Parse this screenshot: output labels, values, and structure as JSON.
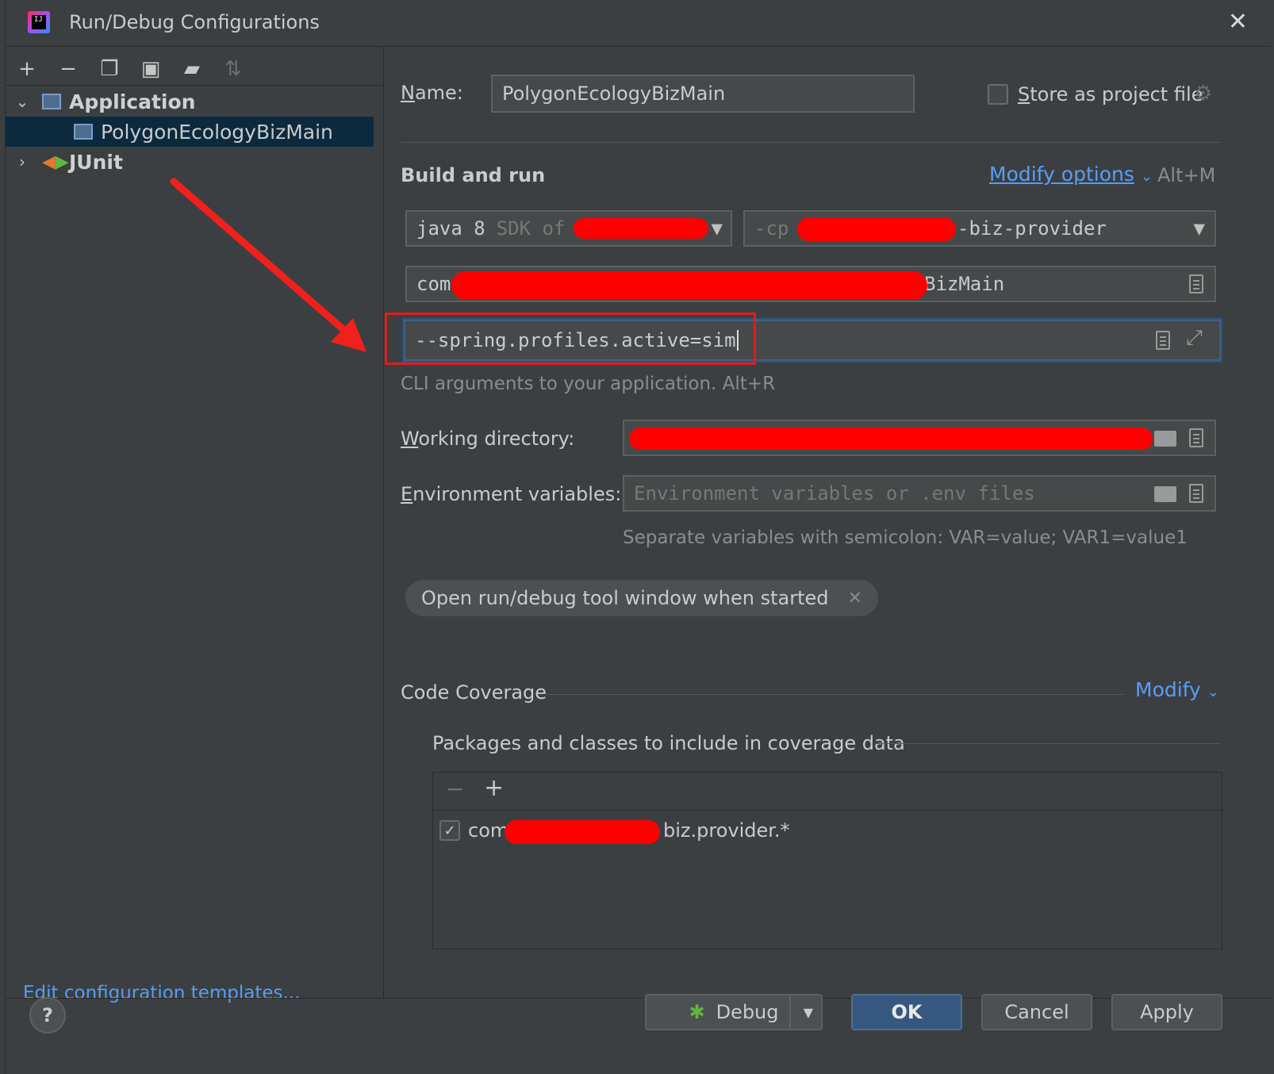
{
  "window": {
    "title": "Run/Debug Configurations"
  },
  "toolbar": {
    "icons": [
      "add-icon",
      "remove-icon",
      "copy-icon",
      "save-icon",
      "new-folder-icon",
      "sort-icon"
    ]
  },
  "tree": {
    "items": [
      {
        "label": "Application",
        "expanded": true
      },
      {
        "label": "PolygonEcologyBizMain",
        "selected": true
      },
      {
        "label": "JUnit",
        "expanded": false
      }
    ]
  },
  "edit_templates_label": "Edit configuration templates...",
  "form": {
    "name_label": "Name:",
    "name_value": "PolygonEcologyBizMain",
    "store_label": "Store as project file",
    "build_run_label": "Build and run",
    "modify_options_label": "Modify options",
    "modify_shortcut": "Alt+M",
    "jdk_prefix": "java 8",
    "jdk_suffix": "SDK of '",
    "cp_prefix": "-cp",
    "cp_suffix": "-biz-provider",
    "main_class_prefix": "com.",
    "main_class_suffix": "BizMain",
    "program_args_value": "--spring.profiles.active=sim",
    "cli_hint": "CLI arguments to your application. Alt+R",
    "working_dir_label": "Working directory:",
    "env_label": "Environment variables:",
    "env_placeholder": "Environment variables or .env files",
    "env_hint": "Separate variables with semicolon: VAR=value; VAR1=value1",
    "chip_label": "Open run/debug tool window when started"
  },
  "coverage": {
    "title": "Code Coverage",
    "modify_label": "Modify",
    "packages_label": "Packages and classes to include in coverage data",
    "entry_prefix": "com",
    "entry_suffix": "biz.provider.*",
    "entry_checked": true
  },
  "buttons": {
    "debug": "Debug",
    "ok": "OK",
    "cancel": "Cancel",
    "apply": "Apply",
    "help": "?"
  },
  "colors": {
    "accent": "#589df6",
    "background": "#3c3f41",
    "annotation": "#e41b1b"
  }
}
